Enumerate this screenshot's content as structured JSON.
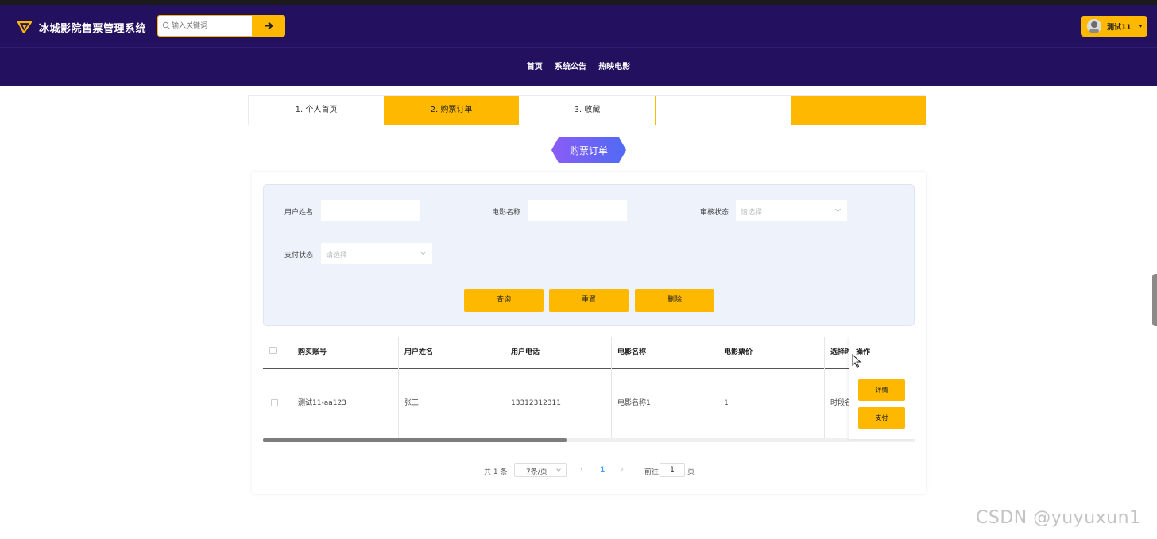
{
  "app": {
    "title": "冰城影院售票管理系统"
  },
  "search": {
    "placeholder": "输入关键词"
  },
  "user": {
    "name": "测试11"
  },
  "nav": [
    "首页",
    "系统公告",
    "热映电影"
  ],
  "tabs": [
    "1. 个人首页",
    "2. 购票订单",
    "3. 收藏",
    "",
    ""
  ],
  "active_tab": 1,
  "page_badge": "购票订单",
  "filters": {
    "user_name_label": "用户姓名",
    "movie_name_label": "电影名称",
    "review_status_label": "审核状态",
    "review_status_placeholder": "请选择",
    "pay_status_label": "支付状态",
    "pay_status_placeholder": "请选择",
    "query_btn": "查询",
    "reset_btn": "重置",
    "delete_btn": "删除"
  },
  "table": {
    "columns": [
      "购买账号",
      "用户姓名",
      "用户电话",
      "电影名称",
      "电影票价",
      "选择时",
      "操作"
    ],
    "rows": [
      {
        "account": "测试11-aa123",
        "user_name": "张三",
        "phone": "13312312311",
        "movie": "电影名称1",
        "price": "1",
        "time": "时段名"
      }
    ],
    "row_actions": {
      "detail": "详情",
      "pay": "支付"
    }
  },
  "pagination": {
    "total_text": "共 1 条",
    "page_size": "7条/页",
    "current_page": "1",
    "goto_label": "前往",
    "goto_value": "1",
    "page_suffix": "页"
  },
  "watermark": "CSDN @yuyuxun1",
  "colors": {
    "header_bg": "#23105f",
    "accent": "#ffb800",
    "badge_from": "#8b5cf6",
    "badge_to": "#4f6bf5"
  }
}
